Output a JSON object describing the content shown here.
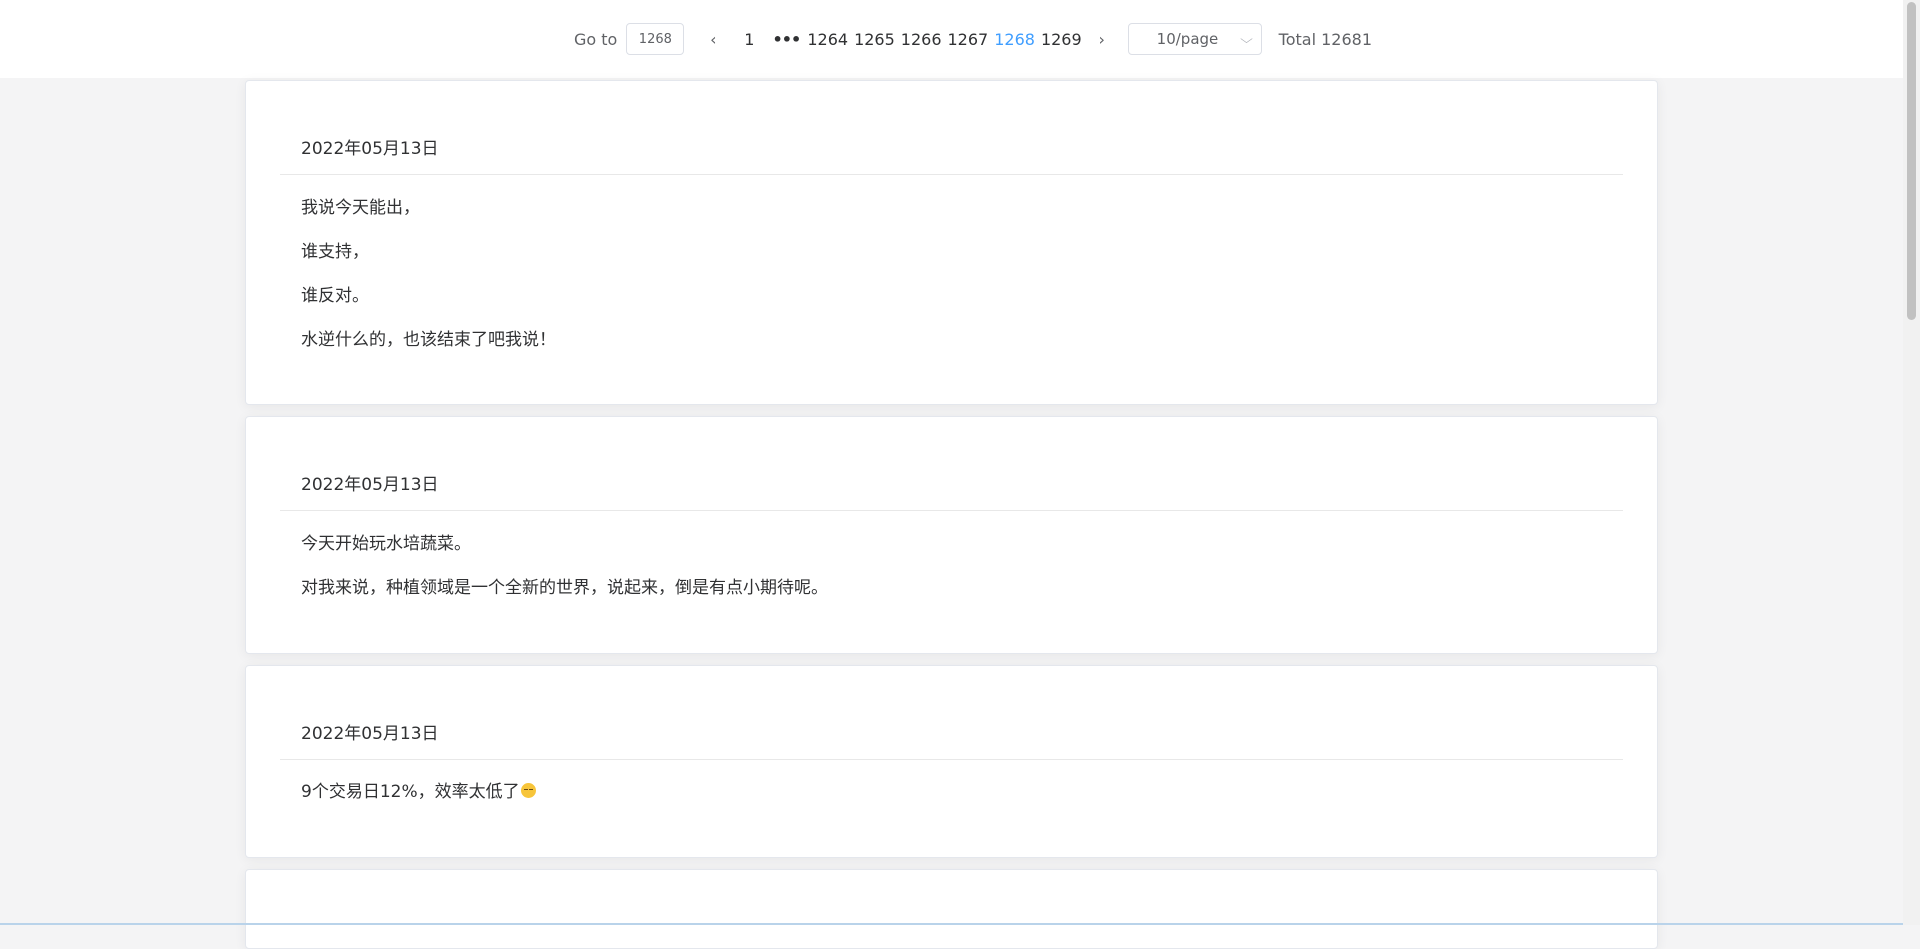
{
  "pagination": {
    "goto_label": "Go to",
    "goto_value": "1268",
    "prev_icon": "‹",
    "next_icon": "›",
    "pages": [
      "1",
      "•••",
      "1264",
      "1265",
      "1266",
      "1267",
      "1268",
      "1269"
    ],
    "current_page": "1268",
    "page_size": "10/page",
    "dropdown_icon": "⌵",
    "total": "Total 12681"
  },
  "posts": [
    {
      "date": "2022年05月13日",
      "lines": [
        "我说今天能出，",
        "谁支持，",
        "谁反对。",
        "水逆什么的，也该结束了吧我说！"
      ]
    },
    {
      "date": "2022年05月13日",
      "lines": [
        "今天开始玩水培蔬菜。",
        "对我来说，种植领域是一个全新的世界，说起来，倒是有点小期待呢。"
      ]
    },
    {
      "date": "2022年05月13日",
      "lines": [
        "9个交易日12%，效率太低了"
      ],
      "emoji": "unamused-face-icon"
    }
  ],
  "colors": {
    "active_page": "#409eff",
    "text": "#303133",
    "muted": "#606266",
    "background": "#f4f4f5"
  }
}
